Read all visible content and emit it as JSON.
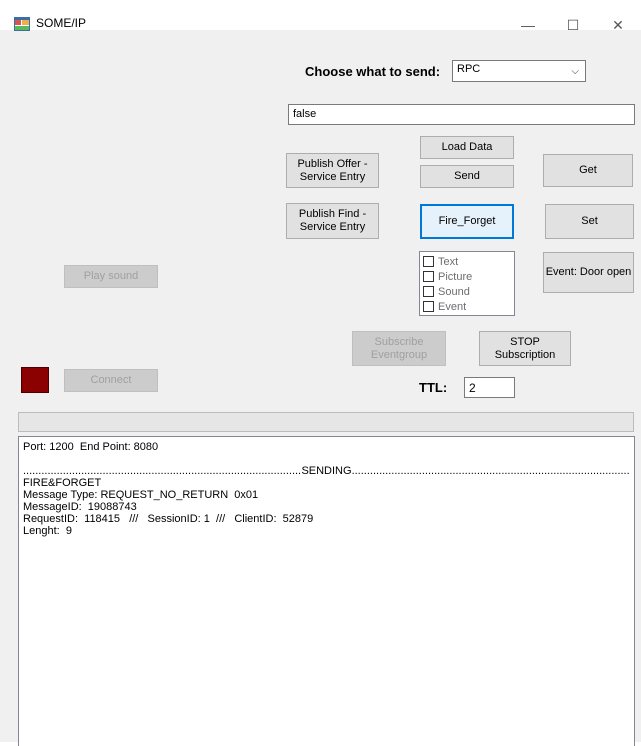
{
  "window": {
    "title": "SOME/IP",
    "minimize": "—",
    "maximize": "☐",
    "close": "✕"
  },
  "send_choice": {
    "label": "Choose what to send:",
    "selected": "RPC"
  },
  "value_input": "false",
  "buttons": {
    "load_data": "Load Data",
    "publish_offer": "Publish Offer - Service Entry",
    "send": "Send",
    "get": "Get",
    "publish_find": "Publish Find - Service Entry",
    "fire_forget": "Fire_Forget",
    "set": "Set",
    "play_sound": "Play sound",
    "event_door_open": "Event: Door open",
    "subscribe_eventgroup": "Subscribe Eventgroup",
    "stop_subscription": "STOP Subscription",
    "connect": "Connect"
  },
  "checklist": [
    "Text",
    "Picture",
    "Sound",
    "Event"
  ],
  "ttl": {
    "label": "TTL:",
    "value": "2"
  },
  "connection_indicator_color": "#8b0000",
  "log": {
    "port_line": "Port: 1200  End Point: 8080",
    "sending_label": "SENDING",
    "lines": [
      "FIRE&FORGET",
      "Message Type: REQUEST_NO_RETURN  0x01",
      "MessageID:  19088743",
      "RequestID:  118415   ///   SessionID: 1  ///   ClientID:  52879",
      "Lenght:  9"
    ]
  }
}
